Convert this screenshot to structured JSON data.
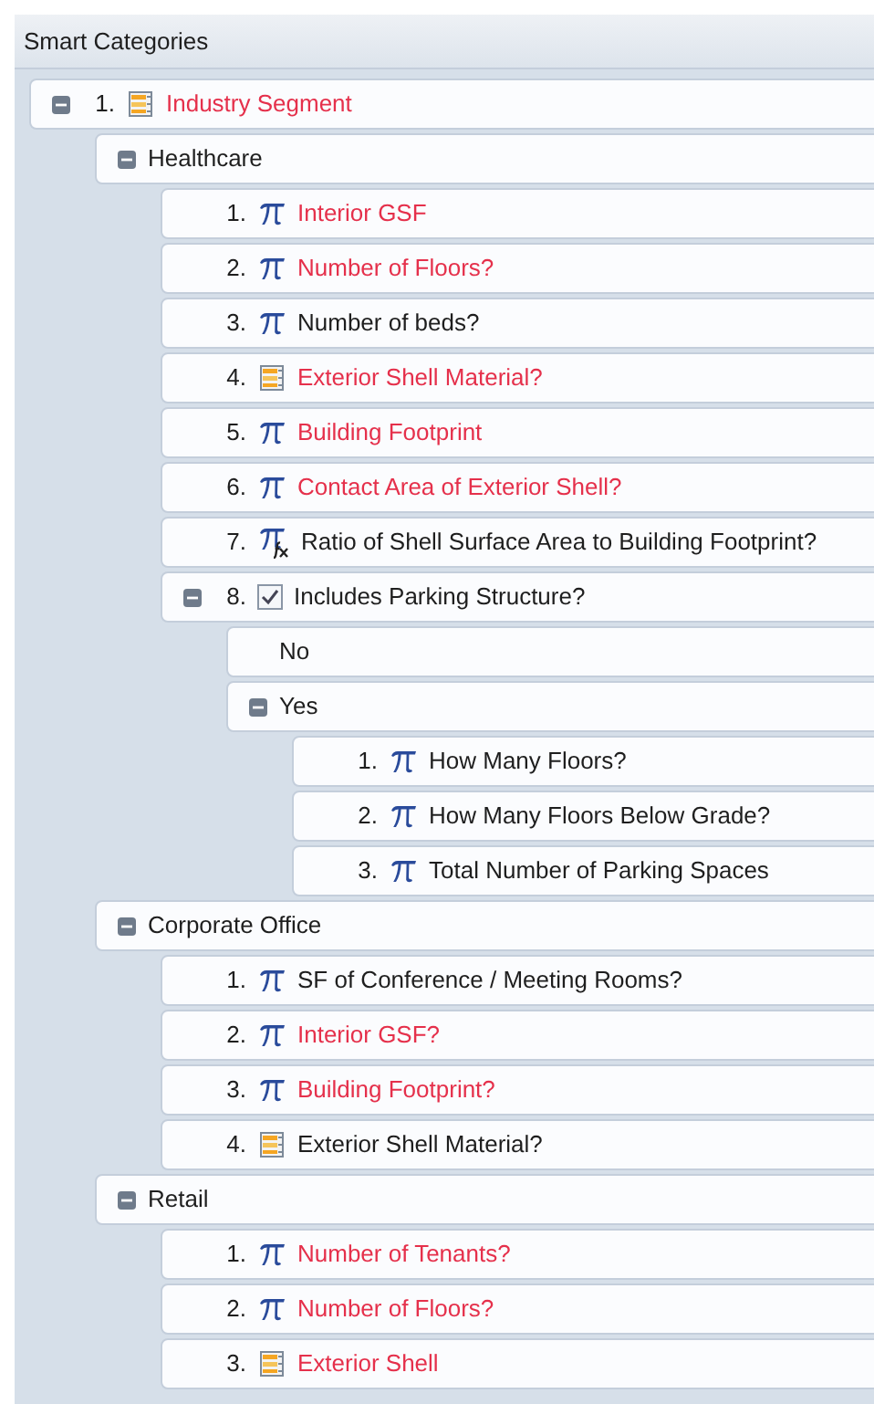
{
  "panel": {
    "title": "Smart Categories"
  },
  "tree": [
    {
      "number": "1.",
      "kind": "list",
      "label": "Industry Segment",
      "required": true,
      "expanded": true,
      "children": [
        {
          "label": "Healthcare",
          "required": false,
          "expanded": true,
          "children": [
            {
              "number": "1.",
              "kind": "pi",
              "label": "Interior GSF",
              "required": true
            },
            {
              "number": "2.",
              "kind": "pi",
              "label": "Number of Floors?",
              "required": true
            },
            {
              "number": "3.",
              "kind": "pi",
              "label": "Number of beds?",
              "required": false
            },
            {
              "number": "4.",
              "kind": "list",
              "label": "Exterior Shell Material?",
              "required": true
            },
            {
              "number": "5.",
              "kind": "pi",
              "label": "Building Footprint",
              "required": true
            },
            {
              "number": "6.",
              "kind": "pi",
              "label": "Contact Area of Exterior Shell?",
              "required": true
            },
            {
              "number": "7.",
              "kind": "formula",
              "label": "Ratio of Shell Surface Area to Building Footprint?",
              "required": false
            },
            {
              "number": "8.",
              "kind": "checkbox",
              "label": "Includes Parking Structure?",
              "required": false,
              "expanded": true,
              "children": [
                {
                  "label": "No",
                  "required": false
                },
                {
                  "label": "Yes",
                  "required": false,
                  "expanded": true,
                  "children": [
                    {
                      "number": "1.",
                      "kind": "pi",
                      "label": "How Many Floors?",
                      "required": false
                    },
                    {
                      "number": "2.",
                      "kind": "pi",
                      "label": "How Many Floors Below Grade?",
                      "required": false
                    },
                    {
                      "number": "3.",
                      "kind": "pi",
                      "label": "Total Number of Parking Spaces",
                      "required": false
                    }
                  ]
                }
              ]
            }
          ]
        },
        {
          "label": "Corporate Office",
          "required": false,
          "expanded": true,
          "children": [
            {
              "number": "1.",
              "kind": "pi",
              "label": "SF of Conference / Meeting Rooms?",
              "required": false
            },
            {
              "number": "2.",
              "kind": "pi",
              "label": "Interior GSF?",
              "required": true
            },
            {
              "number": "3.",
              "kind": "pi",
              "label": "Building Footprint?",
              "required": true
            },
            {
              "number": "4.",
              "kind": "list",
              "label": "Exterior Shell Material?",
              "required": false
            }
          ]
        },
        {
          "label": "Retail",
          "required": false,
          "expanded": true,
          "children": [
            {
              "number": "1.",
              "kind": "pi",
              "label": "Number of Tenants?",
              "required": true
            },
            {
              "number": "2.",
              "kind": "pi",
              "label": "Number of Floors?",
              "required": true
            },
            {
              "number": "3.",
              "kind": "list",
              "label": "Exterior Shell",
              "required": true
            }
          ]
        }
      ]
    }
  ]
}
